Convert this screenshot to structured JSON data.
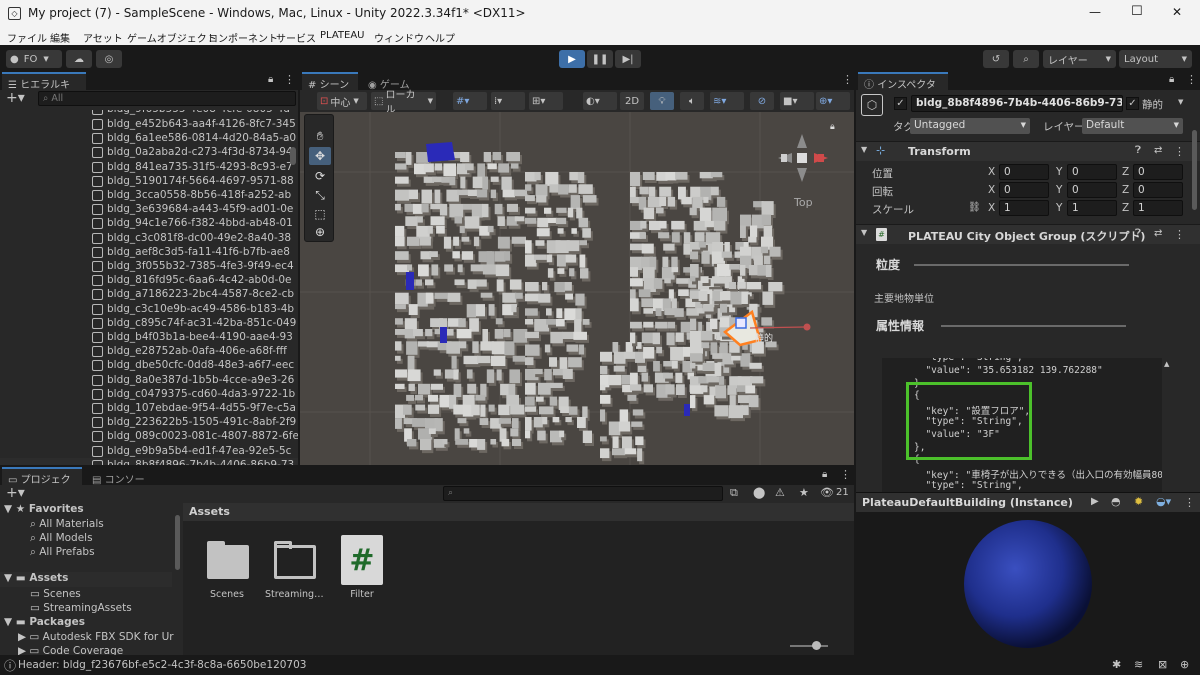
{
  "window": {
    "title": "My project (7) - SampleScene - Windows, Mac, Linux - Unity 2022.3.34f1* <DX11>",
    "min": "—",
    "max": "☐",
    "close": "✕"
  },
  "menu": [
    "ファイル",
    "編集",
    "アセット",
    "ゲームオブジェクト",
    "コンポーネント",
    "サービス",
    "PLATEAU",
    "ウィンドウ",
    "ヘルプ"
  ],
  "toolbar": {
    "account": "FO",
    "layers": "レイヤー",
    "layout": "Layout"
  },
  "hierarchy": {
    "tab": "ヒエラルキー",
    "search_placeholder": "All",
    "items": [
      "bldg_e452b643-aa4f-4126-8fc7-345",
      "bldg_6a1ee586-0814-4d20-84a5-a0",
      "bldg_0a2aba2d-c273-4f3d-8734-94",
      "bldg_841ea735-31f5-4293-8c93-e7",
      "bldg_5190174f-5664-4697-9571-88",
      "bldg_3cca0558-8b56-418f-a252-ab",
      "bldg_3e639684-a443-45f9-ad01-0e",
      "bldg_94c1e766-f382-4bbd-ab48-01",
      "bldg_c3c081f8-dc00-49e2-8a40-38",
      "bldg_aef8c3d5-fa11-41f6-b7fb-ae8",
      "bldg_3f055b32-7385-4fe3-9f49-ec4",
      "bldg_816fd95c-6aa6-4c42-ab0d-0e",
      "bldg_a7186223-2bc4-4587-8ce2-cb",
      "bldg_c3c10e9b-ac49-4586-b183-4b",
      "bldg_c895c74f-ac31-42ba-851c-049",
      "bldg_b4f03b1a-bee4-4190-aae4-93",
      "bldg_e28752ab-0afa-406e-a68f-fff",
      "bldg_dbe50cfc-0dd8-48e3-a6f7-eec",
      "bldg_8a0e387d-1b5b-4cce-a9e3-26",
      "bldg_c0479375-cd60-4da3-9722-1b",
      "bldg_107ebdae-9f54-4d55-9f7e-c5a",
      "bldg_223622b5-1505-491c-8abf-2f9",
      "bldg_089c0023-081c-4807-8872-6fe",
      "bldg_e9b9a5b4-ed1f-47ea-92e5-5c",
      "bldg_8b8f4896-7b4b-4406-86b9-73"
    ]
  },
  "scene": {
    "tab_scene": "シーン",
    "tab_game": "ゲーム",
    "pivot": "中心",
    "space": "ローカル",
    "mode2d": "2D",
    "gizmo_label": "Top",
    "selected_label": "静的"
  },
  "inspector": {
    "tab": "インスペクター",
    "object_name": "bldg_8b8f4896-7b4b-4406-86b9-73",
    "static_label": "静的",
    "tag_label": "タグ",
    "tag_value": "Untagged",
    "layer_label": "レイヤー",
    "layer_value": "Default",
    "transform": {
      "title": "Transform",
      "pos_label": "位置",
      "rot_label": "回転",
      "scale_label": "スケール",
      "axes": [
        "X",
        "Y",
        "Z"
      ],
      "pos": [
        "0",
        "0",
        "0"
      ],
      "rot": [
        "0",
        "0",
        "0"
      ],
      "scale": [
        "1",
        "1",
        "1"
      ]
    },
    "plateau": {
      "title": "PLATEAU City Object Group (スクリプト)",
      "granularity_label": "粒度",
      "granularity_value": "主要地物単位",
      "attr_label": "属性情報"
    },
    "code_lines": [
      "  \"type\": \"String\",",
      "  \"value\": \"35.653182 139.762288\"",
      "}",
      "{",
      "  \"key\": \"設置フロア\",",
      "  \"type\": \"String\",",
      "  \"value\": \"3F\"",
      "},",
      "{",
      "  \"key\": \"車椅子が出入りできる（出入口の有効幅員80c",
      "  \"type\": \"String\","
    ]
  },
  "preview": {
    "title": "PlateauDefaultBuilding (Instance)"
  },
  "project": {
    "tab_project": "プロジェクト",
    "tab_console": "コンソール",
    "hidden_count": "21",
    "favorites": {
      "label": "Favorites",
      "items": [
        "All Materials",
        "All Models",
        "All Prefabs"
      ]
    },
    "assets_root": "Assets",
    "assets_children": [
      "Scenes",
      "StreamingAssets"
    ],
    "packages": "Packages",
    "packages_children": [
      "Autodesk FBX SDK for Ur",
      "Code Coverage"
    ],
    "breadcrumb": "Assets",
    "grid": [
      {
        "label": "Scenes",
        "kind": "folder"
      },
      {
        "label": "Streaming…",
        "kind": "folder"
      },
      {
        "label": "Filter",
        "kind": "script"
      }
    ]
  },
  "status": {
    "text": "Header: bldg_f23676bf-e5c2-4c3f-8c8a-6650be120703"
  },
  "colors": {
    "accent": "#3a79bb",
    "play": "#3d6fa8",
    "highlight": "#4cc12b",
    "sphere": "#1f2f8c",
    "selection": "#ff8020",
    "panel": "#282828",
    "dark": "#191919"
  }
}
